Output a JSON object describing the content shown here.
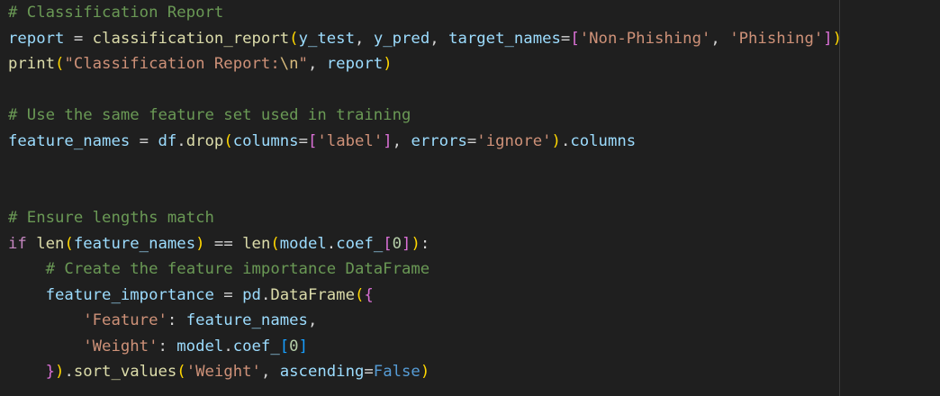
{
  "editor": {
    "lines": [
      [
        {
          "t": "# Classification Report",
          "c": "cm"
        }
      ],
      [
        {
          "t": "report",
          "c": "vr"
        },
        {
          "t": " = ",
          "c": "op"
        },
        {
          "t": "classification_report",
          "c": "fn"
        },
        {
          "t": "(",
          "c": "b1"
        },
        {
          "t": "y_test",
          "c": "vr"
        },
        {
          "t": ", ",
          "c": "op"
        },
        {
          "t": "y_pred",
          "c": "vr"
        },
        {
          "t": ", ",
          "c": "op"
        },
        {
          "t": "target_names",
          "c": "vr"
        },
        {
          "t": "=",
          "c": "op"
        },
        {
          "t": "[",
          "c": "b2"
        },
        {
          "t": "'Non-Phishing'",
          "c": "st"
        },
        {
          "t": ", ",
          "c": "op"
        },
        {
          "t": "'Phishing'",
          "c": "st"
        },
        {
          "t": "]",
          "c": "b2"
        },
        {
          "t": ")",
          "c": "b1"
        }
      ],
      [
        {
          "t": "print",
          "c": "fn"
        },
        {
          "t": "(",
          "c": "b1"
        },
        {
          "t": "\"Classification Report:",
          "c": "st"
        },
        {
          "t": "\\n",
          "c": "esc"
        },
        {
          "t": "\"",
          "c": "st"
        },
        {
          "t": ", ",
          "c": "op"
        },
        {
          "t": "report",
          "c": "vr"
        },
        {
          "t": ")",
          "c": "b1"
        }
      ],
      [],
      [
        {
          "t": "# Use the same feature set used in training",
          "c": "cm"
        }
      ],
      [
        {
          "t": "feature_names",
          "c": "vr"
        },
        {
          "t": " = ",
          "c": "op"
        },
        {
          "t": "df",
          "c": "vr"
        },
        {
          "t": ".",
          "c": "op"
        },
        {
          "t": "drop",
          "c": "fn"
        },
        {
          "t": "(",
          "c": "b1"
        },
        {
          "t": "columns",
          "c": "vr"
        },
        {
          "t": "=",
          "c": "op"
        },
        {
          "t": "[",
          "c": "b2"
        },
        {
          "t": "'label'",
          "c": "st"
        },
        {
          "t": "]",
          "c": "b2"
        },
        {
          "t": ", ",
          "c": "op"
        },
        {
          "t": "errors",
          "c": "vr"
        },
        {
          "t": "=",
          "c": "op"
        },
        {
          "t": "'ignore'",
          "c": "st"
        },
        {
          "t": ")",
          "c": "b1"
        },
        {
          "t": ".",
          "c": "op"
        },
        {
          "t": "columns",
          "c": "vr"
        }
      ],
      [],
      [],
      [
        {
          "t": "# Ensure lengths match",
          "c": "cm"
        }
      ],
      [
        {
          "t": "if",
          "c": "kw"
        },
        {
          "t": " ",
          "c": "op"
        },
        {
          "t": "len",
          "c": "fn"
        },
        {
          "t": "(",
          "c": "b1"
        },
        {
          "t": "feature_names",
          "c": "vr"
        },
        {
          "t": ")",
          "c": "b1"
        },
        {
          "t": " == ",
          "c": "op"
        },
        {
          "t": "len",
          "c": "fn"
        },
        {
          "t": "(",
          "c": "b1"
        },
        {
          "t": "model",
          "c": "vr"
        },
        {
          "t": ".",
          "c": "op"
        },
        {
          "t": "coef_",
          "c": "vr"
        },
        {
          "t": "[",
          "c": "b2"
        },
        {
          "t": "0",
          "c": "nm"
        },
        {
          "t": "]",
          "c": "b2"
        },
        {
          "t": ")",
          "c": "b1"
        },
        {
          "t": ":",
          "c": "op"
        }
      ],
      [
        {
          "t": "    ",
          "c": "op"
        },
        {
          "t": "# Create the feature importance DataFrame",
          "c": "cm"
        }
      ],
      [
        {
          "t": "    ",
          "c": "op"
        },
        {
          "t": "feature_importance",
          "c": "vr"
        },
        {
          "t": " = ",
          "c": "op"
        },
        {
          "t": "pd",
          "c": "vr"
        },
        {
          "t": ".",
          "c": "op"
        },
        {
          "t": "DataFrame",
          "c": "fn"
        },
        {
          "t": "(",
          "c": "b1"
        },
        {
          "t": "{",
          "c": "b2"
        }
      ],
      [
        {
          "t": "        ",
          "c": "op"
        },
        {
          "t": "'Feature'",
          "c": "st"
        },
        {
          "t": ": ",
          "c": "op"
        },
        {
          "t": "feature_names",
          "c": "vr"
        },
        {
          "t": ",",
          "c": "op"
        }
      ],
      [
        {
          "t": "        ",
          "c": "op"
        },
        {
          "t": "'Weight'",
          "c": "st"
        },
        {
          "t": ": ",
          "c": "op"
        },
        {
          "t": "model",
          "c": "vr"
        },
        {
          "t": ".",
          "c": "op"
        },
        {
          "t": "coef_",
          "c": "vr"
        },
        {
          "t": "[",
          "c": "b3"
        },
        {
          "t": "0",
          "c": "nm"
        },
        {
          "t": "]",
          "c": "b3"
        }
      ],
      [
        {
          "t": "    ",
          "c": "op"
        },
        {
          "t": "}",
          "c": "b2"
        },
        {
          "t": ")",
          "c": "b1"
        },
        {
          "t": ".",
          "c": "op"
        },
        {
          "t": "sort_values",
          "c": "fn"
        },
        {
          "t": "(",
          "c": "b1"
        },
        {
          "t": "'Weight'",
          "c": "st"
        },
        {
          "t": ", ",
          "c": "op"
        },
        {
          "t": "ascending",
          "c": "vr"
        },
        {
          "t": "=",
          "c": "op"
        },
        {
          "t": "False",
          "c": "ct"
        },
        {
          "t": ")",
          "c": "b1"
        }
      ]
    ]
  },
  "colors": {
    "background": "#1f1f1f",
    "comment": "#6a9955",
    "variable": "#9cdcfe",
    "function": "#dcdcaa",
    "string": "#ce9178",
    "keyword": "#c586c0",
    "constant": "#569cd6",
    "number": "#b5cea8",
    "bracket_level1": "#ffd700",
    "bracket_level2": "#da70d6",
    "bracket_level3": "#179fff"
  }
}
